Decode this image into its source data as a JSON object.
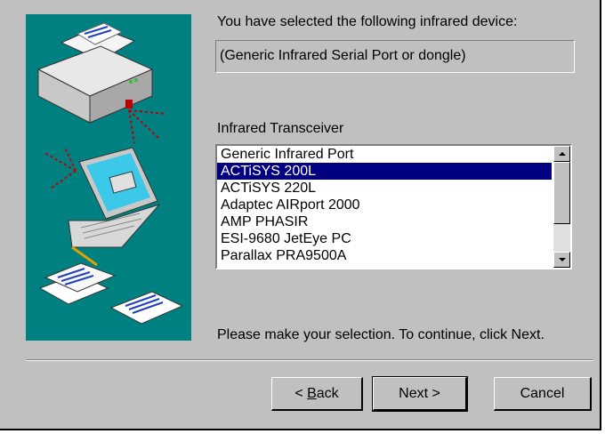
{
  "dialog": {
    "selected_device_label": "You have selected the following infrared device:",
    "selected_device_value": "(Generic Infrared Serial Port or dongle)",
    "transceiver_label": "Infrared Transceiver",
    "transceivers": [
      "Generic Infrared Port",
      "ACTiSYS 200L",
      "ACTiSYS 220L",
      "Adaptec AIRport 2000",
      "AMP PHASIR",
      "ESI-9680 JetEye PC",
      "Parallax PRA9500A"
    ],
    "selected_index": 1,
    "instruction": "Please make your selection.  To continue, click Next."
  },
  "buttons": {
    "back_prefix": "< ",
    "back_accel": "B",
    "back_rest": "ack",
    "next": "Next >",
    "cancel": "Cancel"
  },
  "illustration": {
    "icons": [
      "printer-icon",
      "laptop-icon",
      "documents-icon"
    ],
    "background_color": "#008080"
  }
}
